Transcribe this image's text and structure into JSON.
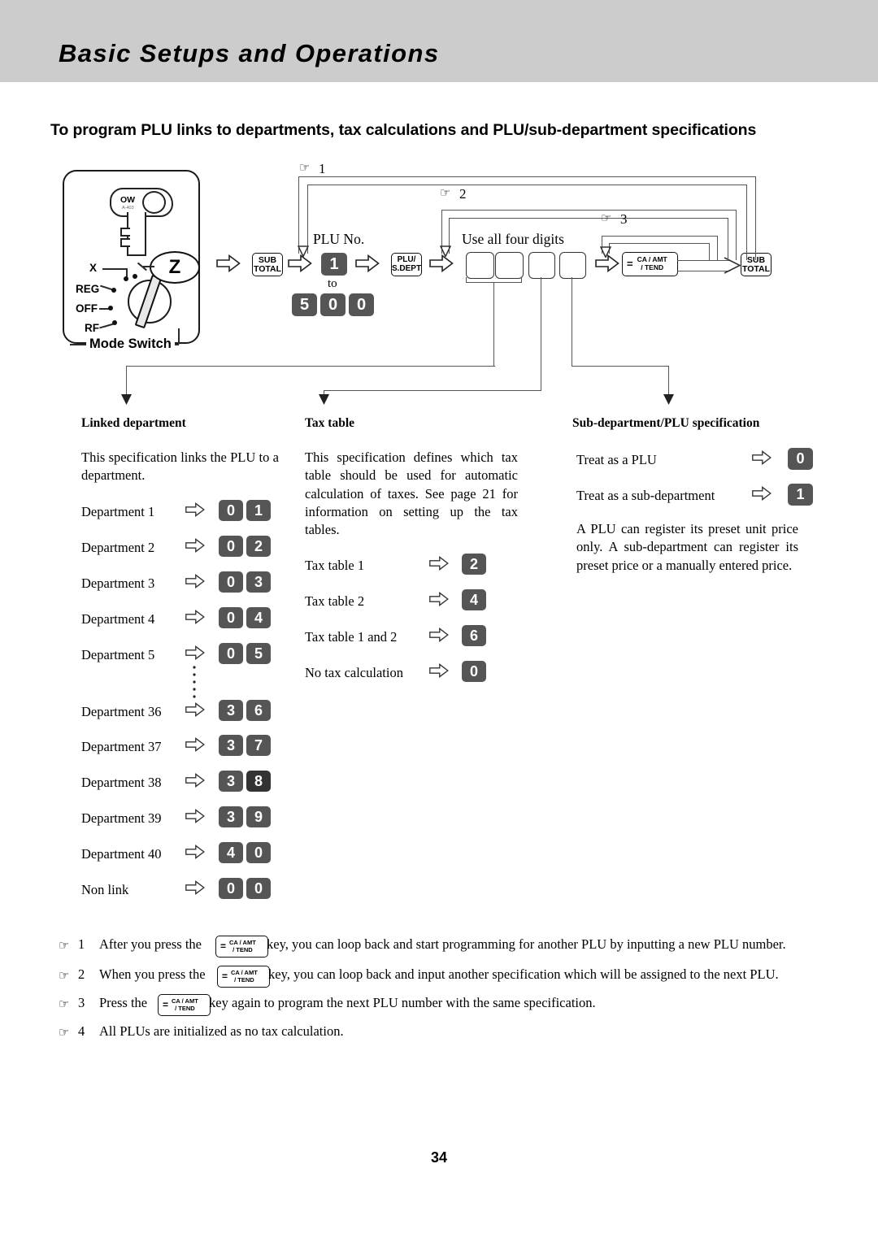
{
  "header": {
    "title": "Basic Setups and Operations",
    "band_color": "#cccccc"
  },
  "section": {
    "heading": "To program PLU links to departments, tax calculations and PLU/sub-department specifications"
  },
  "mode_switch": {
    "label": "Mode Switch",
    "selected": "Z",
    "key_text": "OW",
    "key_subtext": "A-403",
    "positions": [
      "X",
      "REG",
      "OFF",
      "RF"
    ]
  },
  "flow": {
    "sub_total_key": {
      "line1": "SUB",
      "line2": "TOTAL"
    },
    "plu_sdept_key": {
      "line1": "PLU/",
      "line2": "S.DEPT"
    },
    "ca_amt_key": {
      "eq": "=",
      "line1": "CA / AMT",
      "line2": "/ TEND"
    },
    "sub_total_key_end": {
      "line1": "SUB",
      "line2": "TOTAL"
    },
    "plu_no_label": "PLU No.",
    "range_from": "1",
    "range_to_word": "to",
    "range_to": [
      "5",
      "0",
      "0"
    ],
    "four_digits_label": "Use all four digits",
    "loop_markers": [
      "1",
      "2",
      "3"
    ],
    "arrow_icon": "right-hollow-arrow"
  },
  "columns": {
    "linked_department": {
      "heading": "Linked department",
      "paragraph": "This specification links the PLU to a department.",
      "rows": [
        {
          "label": "Department 1",
          "code": [
            "0",
            "1"
          ]
        },
        {
          "label": "Department 2",
          "code": [
            "0",
            "2"
          ]
        },
        {
          "label": "Department 3",
          "code": [
            "0",
            "3"
          ]
        },
        {
          "label": "Department 4",
          "code": [
            "0",
            "4"
          ]
        },
        {
          "label": "Department 5",
          "code": [
            "0",
            "5"
          ]
        },
        {
          "label": "Department 36",
          "code": [
            "3",
            "6"
          ]
        },
        {
          "label": "Department 37",
          "code": [
            "3",
            "7"
          ]
        },
        {
          "label": "Department 38",
          "code": [
            "3",
            "8"
          ]
        },
        {
          "label": "Department 39",
          "code": [
            "3",
            "9"
          ]
        },
        {
          "label": "Department 40",
          "code": [
            "4",
            "0"
          ]
        },
        {
          "label": "Non link",
          "code": [
            "0",
            "0"
          ]
        }
      ]
    },
    "tax_table": {
      "heading": "Tax table",
      "paragraph": "This specification defines which tax table should be used for automatic calculation of taxes. See page 21 for information on setting up the tax tables.",
      "rows": [
        {
          "label": "Tax table 1",
          "code": [
            "2"
          ]
        },
        {
          "label": "Tax table 2",
          "code": [
            "4"
          ]
        },
        {
          "label": "Tax table 1 and 2",
          "code": [
            "6"
          ]
        },
        {
          "label": "No tax calculation",
          "code": [
            "0"
          ]
        }
      ]
    },
    "sub_department": {
      "heading": "Sub-department/PLU specification",
      "rows": [
        {
          "label": "Treat as a PLU",
          "code": [
            "0"
          ]
        },
        {
          "label": "Treat as a sub-department",
          "code": [
            "1"
          ]
        }
      ],
      "paragraph": "A PLU can register its preset unit price only. A sub-department can register its preset price or a manually entered price."
    }
  },
  "footnotes": [
    {
      "num": "1",
      "before": "After you press the",
      "after": "key, you can loop back and start programming for another PLU by inputting a new PLU number.",
      "has_key": true
    },
    {
      "num": "2",
      "before": "When you press the",
      "after": "key, you can loop back and input another specification which will be assigned to the next PLU.",
      "has_key": true
    },
    {
      "num": "3",
      "before": "Press the",
      "after": "key again to program the next PLU number with the same specification.",
      "has_key": true
    },
    {
      "num": "4",
      "before": "All PLUs are initialized as no tax calculation.",
      "after": "",
      "has_key": false
    }
  ],
  "page_number": "34"
}
